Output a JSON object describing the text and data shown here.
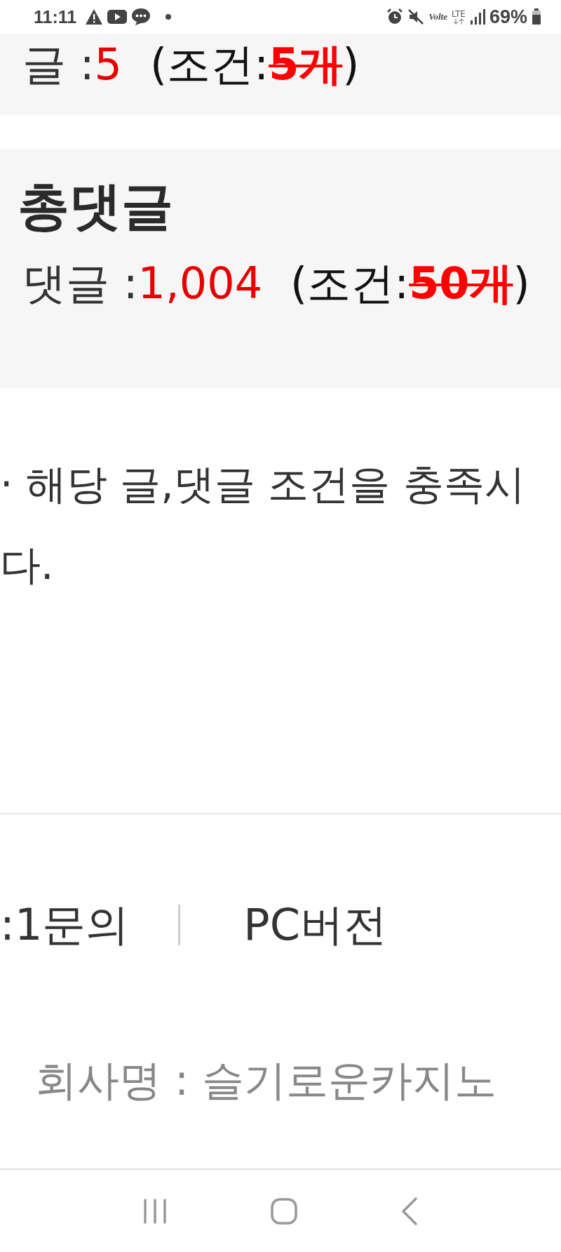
{
  "status_bar": {
    "time": "11:11",
    "volte": "Volte",
    "network": "LTE",
    "battery": "69%"
  },
  "cards": [
    {
      "label": "글 :",
      "count": "5",
      "condition_open": "(조건:",
      "condition_value": "5개",
      "struck": true,
      "condition_close": ")"
    },
    {
      "title": "총댓글",
      "label": "댓글 :",
      "count": "1,004",
      "condition_open": "(조건:",
      "condition_value": "50개",
      "struck": true,
      "condition_close": ")"
    }
  ],
  "notice": {
    "line_1": "· 해당 글,댓글 조건을 충족시",
    "line_2": "다."
  },
  "footer": {
    "links": [
      ":1문의",
      "PC버전"
    ],
    "company": "회사명 : 슬기로운카지노"
  }
}
